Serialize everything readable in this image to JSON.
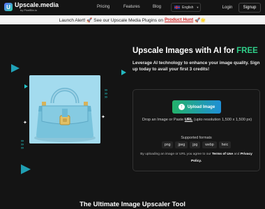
{
  "nav": {
    "logo_name": "Upscale.media",
    "logo_by": "by PixelBin.io",
    "links": [
      "Pricing",
      "Features",
      "Blog"
    ],
    "language": "English",
    "login_label": "Login",
    "signup_label": "Signup"
  },
  "banner": {
    "text": "Launch Alert! 🚀 See our Upscale Media Plugins on",
    "link_text": "Product Hunt",
    "suffix": "🚀🌟"
  },
  "hero": {
    "title": "Upscale Images with AI for",
    "title_highlight": "FREE",
    "subtitle": "Leverage AI technology to enhance your image quality. Sign up today to avail your first 3 credits!"
  },
  "upload": {
    "button_label": "Upload Image",
    "drop_prefix": "Drop an Image or Paste",
    "drop_url": "URL",
    "drop_suffix": "(upto resolution 1,500 x 1,500 px)",
    "formats_label": "Supported formats",
    "formats": [
      "png",
      "jpeg",
      "jpg",
      "webp",
      "heic"
    ],
    "terms_prefix": "By uploading an image or URL you agree to our",
    "terms_link": "Terms of Use",
    "terms_and": "and",
    "privacy_link": "Privacy Policy."
  },
  "bottom": {
    "title": "The Ultimate Image Upscaler Tool"
  },
  "colors": {
    "accent_green": "#2fd08a",
    "alert_red": "#d62828",
    "teal_shapes": "#1fa1b7"
  }
}
